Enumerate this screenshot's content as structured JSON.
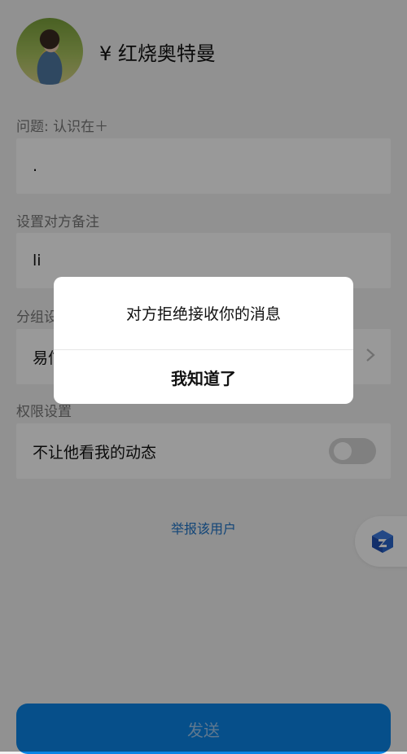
{
  "header": {
    "username": "¥ 红烧奥特曼"
  },
  "question": {
    "label": "问题: 认识在＋",
    "answer": "."
  },
  "remark": {
    "label": "设置对方备注",
    "value": "li"
  },
  "group": {
    "label": "分组设置",
    "value": "易信"
  },
  "permissions": {
    "label": "权限设置",
    "hide_moments_label": "不让他看我的动态",
    "hide_moments_enabled": false
  },
  "report_link": "举报该用户",
  "send_button": "发送",
  "dialog": {
    "message": "对方拒绝接收你的消息",
    "button": "我知道了"
  },
  "colors": {
    "accent": "#0a84e6",
    "link": "#1e74c8"
  },
  "icons": {
    "floating": "cube-icon",
    "chevron": "chevron-right-icon"
  }
}
